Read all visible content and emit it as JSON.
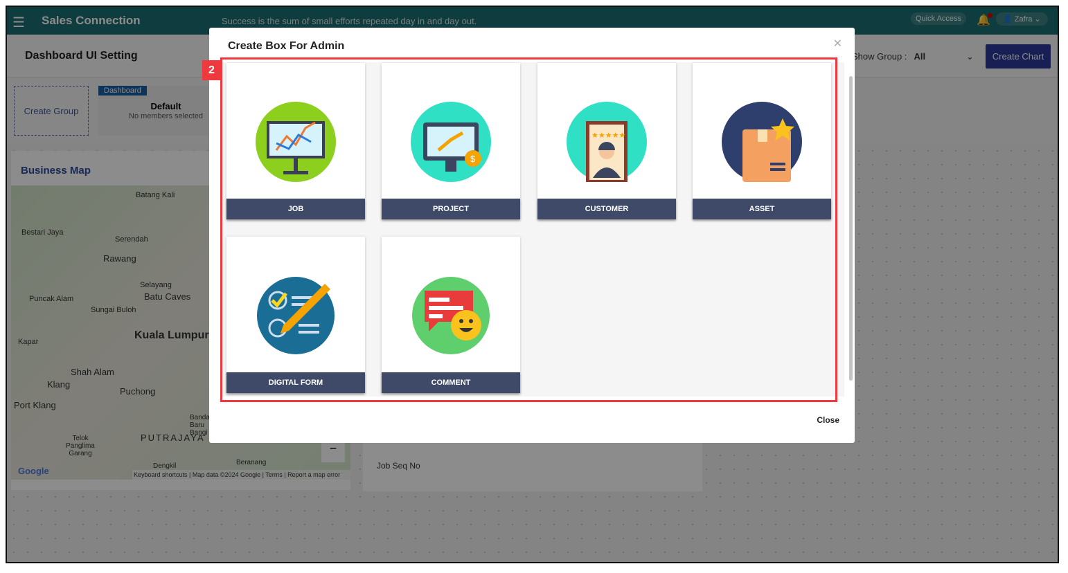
{
  "header": {
    "app_title": "Sales Connection",
    "quote": "Success is the sum of small efforts repeated day in and day out.",
    "quick_access": "Quick Access",
    "user": "Zafra"
  },
  "subheader": {
    "title": "Dashboard UI Setting",
    "show_group_label": "Show Group :",
    "show_group_value": "All",
    "create_chart": "Create Chart"
  },
  "groups": {
    "create_group": "Create Group",
    "tag": "Dashboard",
    "name": "Default",
    "members": "No members selected"
  },
  "business_map": {
    "title": "Business Map",
    "labels": [
      "Batang Kali",
      "Bestari Jaya",
      "Serendah",
      "Rawang",
      "Selayang",
      "Batu Caves",
      "Puncak Alam",
      "Sungai Buloh",
      "Kapar",
      "Kuala Lumpur",
      "Shah Alam",
      "Klang",
      "Puchong",
      "Port Klang",
      "Telok Panglima Garang",
      "PUTRAJAYA",
      "Bandar Baru Bangi",
      "Dengkil",
      "Beranang"
    ],
    "footer": "Keyboard shortcuts | Map data ©2024 Google | Terms | Report a map error",
    "google": "Google"
  },
  "job_panel": {
    "label": "Job Seq No"
  },
  "modal": {
    "title": "Create Box For Admin",
    "close": "Close",
    "items": [
      {
        "label": "JOB",
        "icon": "presentation-chart-icon"
      },
      {
        "label": "PROJECT",
        "icon": "monitor-growth-icon"
      },
      {
        "label": "CUSTOMER",
        "icon": "customer-rating-icon"
      },
      {
        "label": "ASSET",
        "icon": "asset-box-icon"
      },
      {
        "label": "DIGITAL FORM",
        "icon": "checklist-pencil-icon"
      },
      {
        "label": "COMMENT",
        "icon": "chat-emoji-icon"
      }
    ]
  },
  "annotation": {
    "badge": "2",
    "color": "#f0393f"
  }
}
